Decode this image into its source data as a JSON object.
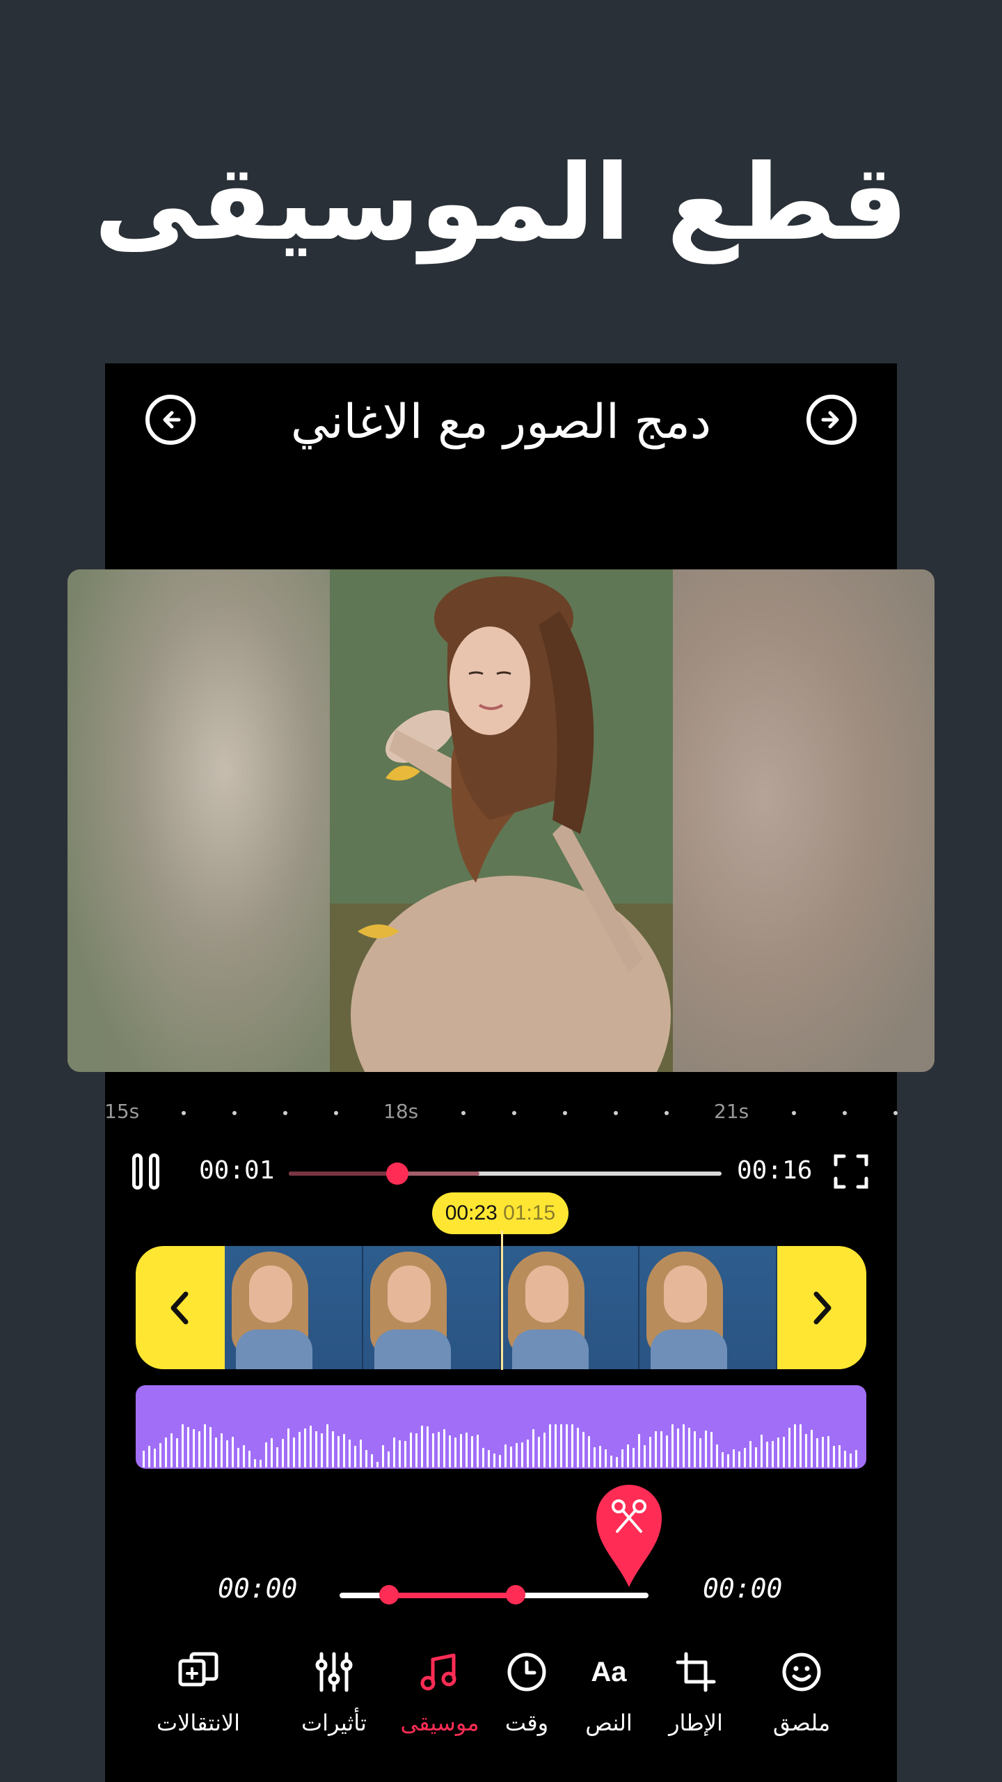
{
  "headline": "قطع الموسيقى",
  "appbar": {
    "title": "دمج الصور مع الاغاني",
    "back_icon": "circle-arrow-left-icon",
    "forward_icon": "circle-arrow-right-icon"
  },
  "timeline_ticks": [
    "15s",
    "18s",
    "21s"
  ],
  "player": {
    "current_time": "00:01",
    "total_time": "00:16",
    "progress": 0.25,
    "buffered": 0.44
  },
  "clip_badge": {
    "current": "00:23",
    "total": "01:15"
  },
  "music_cut": {
    "start_time": "00:00",
    "end_time": "00:00",
    "range_start": 0.16,
    "range_end": 0.57
  },
  "tabs": [
    {
      "label": "ملصق",
      "icon": "smiley-icon"
    },
    {
      "label": "الإطار",
      "icon": "crop-icon"
    },
    {
      "label": "النص",
      "icon": "text-aa-icon",
      "glyph": "Aa"
    },
    {
      "label": "وقت",
      "icon": "clock-icon"
    },
    {
      "label": "موسيقى",
      "icon": "music-note-icon",
      "active": true
    },
    {
      "label": "تأثيرات",
      "icon": "sliders-icon"
    },
    {
      "label": "الانتقالات",
      "icon": "transitions-icon"
    }
  ],
  "colors": {
    "accent": "#ff2d55",
    "highlight": "#ffe633",
    "audio_track": "#a16ef8",
    "background": "#2a3037"
  }
}
